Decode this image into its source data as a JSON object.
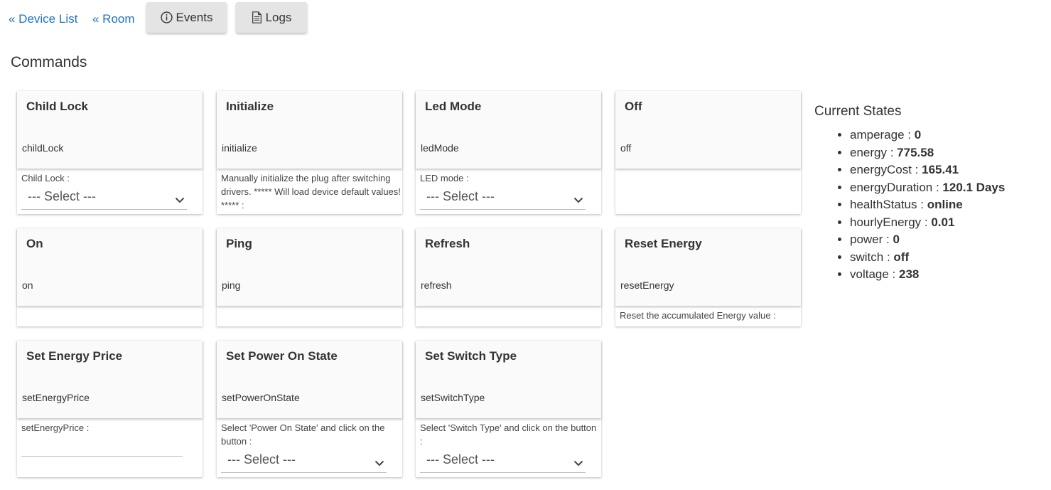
{
  "nav": {
    "device_list": "« Device List",
    "room": "« Room",
    "events": "Events",
    "logs": "Logs"
  },
  "section_title": "Commands",
  "commands": [
    {
      "title": "Child Lock",
      "name": "childLock",
      "param_label": "Child Lock :",
      "select": "--- Select ---"
    },
    {
      "title": "Initialize",
      "name": "initialize",
      "param_label": "Manually initialize the plug after switching drivers. ***** Will load device default values! ***** :"
    },
    {
      "title": "Led Mode",
      "name": "ledMode",
      "param_label": "LED mode :",
      "select": "--- Select ---"
    },
    {
      "title": "Off",
      "name": "off"
    },
    {
      "title": "On",
      "name": "on"
    },
    {
      "title": "Ping",
      "name": "ping"
    },
    {
      "title": "Refresh",
      "name": "refresh"
    },
    {
      "title": "Reset Energy",
      "name": "resetEnergy",
      "param_label": "Reset the accumulated Energy value :"
    },
    {
      "title": "Set Energy Price",
      "name": "setEnergyPrice",
      "param_label": "setEnergyPrice :",
      "input_value": ""
    },
    {
      "title": "Set Power On State",
      "name": "setPowerOnState",
      "param_label": "Select 'Power On State' and click on the button :",
      "select": "--- Select ---"
    },
    {
      "title": "Set Switch Type",
      "name": "setSwitchType",
      "param_label": "Select 'Switch Type' and click on the button :",
      "select": "--- Select ---"
    }
  ],
  "current_states": {
    "title": "Current States",
    "items": [
      {
        "key": "amperage",
        "value": "0"
      },
      {
        "key": "energy",
        "value": "775.58"
      },
      {
        "key": "energyCost",
        "value": "165.41"
      },
      {
        "key": "energyDuration",
        "value": "120.1 Days"
      },
      {
        "key": "healthStatus",
        "value": "online"
      },
      {
        "key": "hourlyEnergy",
        "value": "0.01"
      },
      {
        "key": "power",
        "value": "0"
      },
      {
        "key": "switch",
        "value": "off"
      },
      {
        "key": "voltage",
        "value": "238"
      }
    ]
  },
  "colors": {
    "link": "#1e73c4",
    "button_bg": "#e4e4e4",
    "card_bg": "#fafafa"
  },
  "icons": {
    "events": "info-circle-icon",
    "logs": "document-icon",
    "select": "chevron-down-icon"
  }
}
